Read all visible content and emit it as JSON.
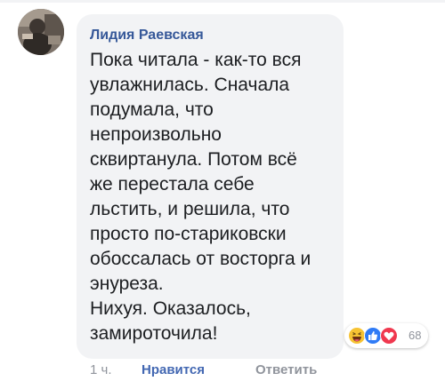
{
  "comment": {
    "author": "Лидия Раевская",
    "lines": [
      "Пока читала - как-то вся",
      "увлажнилась. Сначала",
      "подумала, что",
      "непроизвольно",
      "сквиртанула. Потом всё",
      "же перестала себе",
      "льстить, и решила, что",
      "просто по-стариковски",
      "обоссалась от восторга и",
      "энуреза.",
      "Нихуя. Оказалось,",
      "замироточила!"
    ]
  },
  "reactions": {
    "icons": [
      "haha-reaction-icon",
      "like-reaction-icon",
      "love-reaction-icon"
    ],
    "count": "68"
  },
  "actions": {
    "time": "1 ч.",
    "like_label": "Нравится",
    "reply_label": "Ответить"
  },
  "colors": {
    "author": "#365899",
    "bubble": "#f2f3f5",
    "link": "#4267b2",
    "muted": "#90949c"
  }
}
